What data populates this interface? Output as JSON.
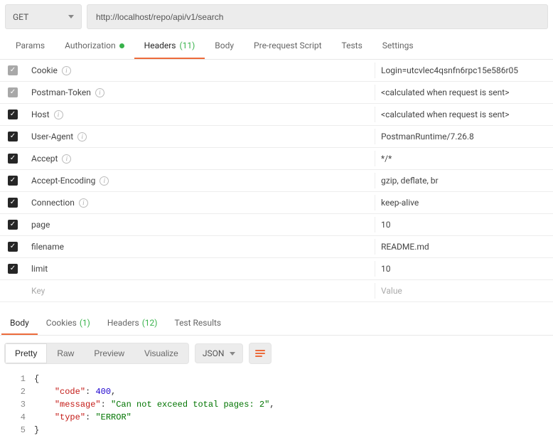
{
  "request": {
    "method": "GET",
    "url": "http://localhost/repo/api/v1/search"
  },
  "tabs": {
    "params": "Params",
    "authorization": "Authorization",
    "headers": "Headers",
    "headersCount": "(11)",
    "body": "Body",
    "prerequest": "Pre-request Script",
    "tests": "Tests",
    "settings": "Settings"
  },
  "headers": [
    {
      "checked": true,
      "disabled": true,
      "key": "Cookie",
      "info": true,
      "value": "Login=utcvlec4qsnfn6rpc15e586r05"
    },
    {
      "checked": true,
      "disabled": true,
      "key": "Postman-Token",
      "info": true,
      "value": "<calculated when request is sent>"
    },
    {
      "checked": true,
      "disabled": false,
      "key": "Host",
      "info": true,
      "value": "<calculated when request is sent>"
    },
    {
      "checked": true,
      "disabled": false,
      "key": "User-Agent",
      "info": true,
      "value": "PostmanRuntime/7.26.8"
    },
    {
      "checked": true,
      "disabled": false,
      "key": "Accept",
      "info": true,
      "value": "*/*"
    },
    {
      "checked": true,
      "disabled": false,
      "key": "Accept-Encoding",
      "info": true,
      "value": "gzip, deflate, br"
    },
    {
      "checked": true,
      "disabled": false,
      "key": "Connection",
      "info": true,
      "value": "keep-alive"
    },
    {
      "checked": true,
      "disabled": false,
      "key": "page",
      "info": false,
      "value": "10"
    },
    {
      "checked": true,
      "disabled": false,
      "key": "filename",
      "info": false,
      "value": "README.md"
    },
    {
      "checked": true,
      "disabled": false,
      "key": "limit",
      "info": false,
      "value": "10"
    }
  ],
  "headerPlaceholder": {
    "key": "Key",
    "value": "Value"
  },
  "responseTabs": {
    "body": "Body",
    "cookies": "Cookies",
    "cookiesCount": "(1)",
    "headers": "Headers",
    "headersCount": "(12)",
    "testResults": "Test Results"
  },
  "viewModes": {
    "pretty": "Pretty",
    "raw": "Raw",
    "preview": "Preview",
    "visualize": "Visualize",
    "format": "JSON"
  },
  "responseBody": {
    "lines": [
      "1",
      "2",
      "3",
      "4",
      "5"
    ],
    "tokens": [
      [
        {
          "t": "brace",
          "v": "{"
        }
      ],
      [
        {
          "t": "indent",
          "v": "    "
        },
        {
          "t": "key",
          "v": "\"code\""
        },
        {
          "t": "punc",
          "v": ": "
        },
        {
          "t": "num",
          "v": "400"
        },
        {
          "t": "punc",
          "v": ","
        }
      ],
      [
        {
          "t": "indent",
          "v": "    "
        },
        {
          "t": "key",
          "v": "\"message\""
        },
        {
          "t": "punc",
          "v": ": "
        },
        {
          "t": "str",
          "v": "\"Can not exceed total pages: 2\""
        },
        {
          "t": "punc",
          "v": ","
        }
      ],
      [
        {
          "t": "indent",
          "v": "    "
        },
        {
          "t": "key",
          "v": "\"type\""
        },
        {
          "t": "punc",
          "v": ": "
        },
        {
          "t": "str",
          "v": "\"ERROR\""
        }
      ],
      [
        {
          "t": "brace",
          "v": "}"
        }
      ]
    ]
  }
}
